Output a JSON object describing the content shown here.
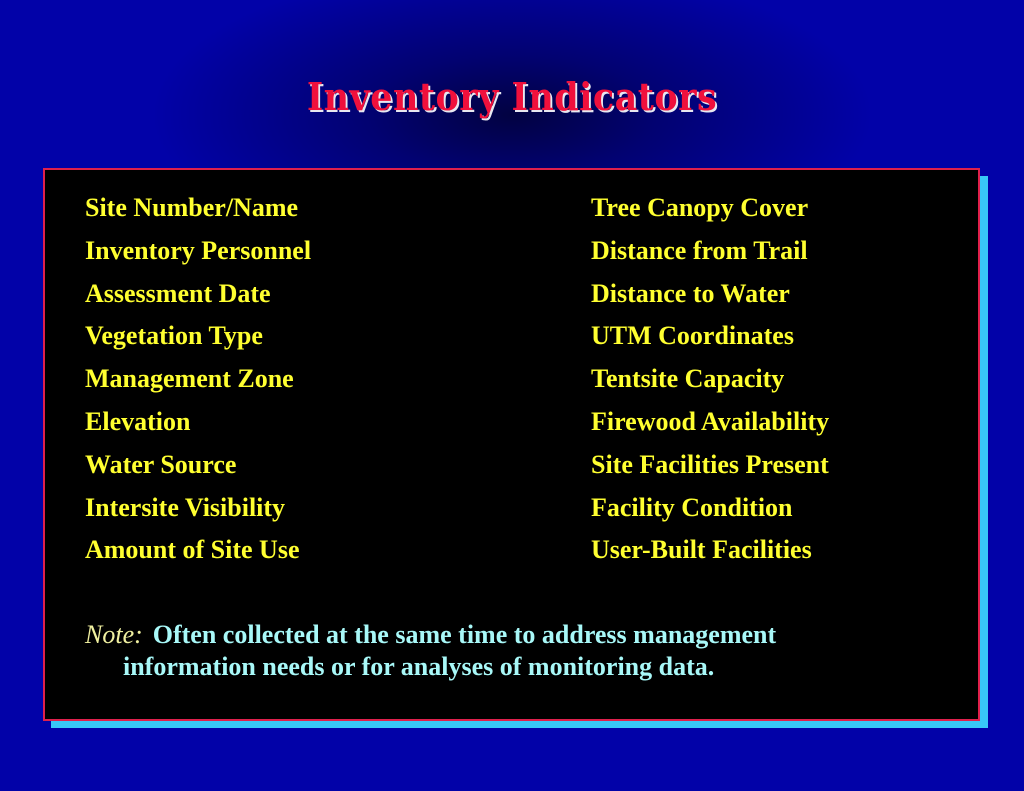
{
  "slide": {
    "title": "Inventory Indicators",
    "colors": {
      "background": "#0202a8",
      "title": "#f0103c",
      "panel": "#000000",
      "panel_border": "#e0204c",
      "panel_shadow": "#38c8f8",
      "list_text": "#ffff30",
      "note_text": "#a8f8f8"
    },
    "left_column": [
      "Site Number/Name",
      "Inventory Personnel",
      "Assessment Date",
      "Vegetation Type",
      "Management Zone",
      "Elevation",
      "Water Source",
      "Intersite Visibility",
      "Amount of Site Use"
    ],
    "right_column": [
      "Tree Canopy Cover",
      "Distance from Trail",
      "Distance to Water",
      "UTM Coordinates",
      "Tentsite Capacity",
      "Firewood Availability",
      "Site Facilities Present",
      "Facility Condition",
      "User-Built Facilities"
    ],
    "note": {
      "label": "Note:",
      "line1": "Often collected at the same time to address management",
      "line2": "information needs or for analyses of monitoring data."
    }
  }
}
